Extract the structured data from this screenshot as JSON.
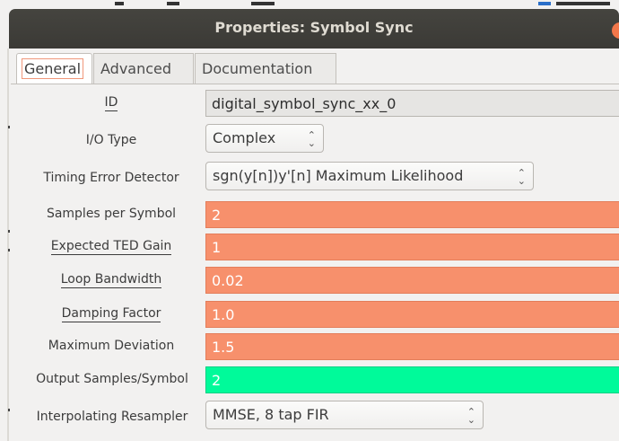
{
  "window": {
    "title": "Properties: Symbol Sync",
    "close_symbol": "×"
  },
  "tabs": [
    {
      "label": "General",
      "active": true
    },
    {
      "label": "Advanced",
      "active": false
    },
    {
      "label": "Documentation",
      "active": false
    }
  ],
  "params": {
    "id": {
      "label": "ID",
      "value": "digital_symbol_sync_xx_0"
    },
    "io_type": {
      "label": "I/O Type",
      "value": "Complex",
      "options": [
        "Complex"
      ]
    },
    "ted": {
      "label": "Timing Error Detector",
      "value": "sgn(y[n])y'[n] Maximum Likelihood"
    },
    "sps": {
      "label": "Samples per Symbol",
      "value": "2"
    },
    "ted_gain": {
      "label": "Expected TED Gain",
      "value": "1"
    },
    "loop_bw": {
      "label": "Loop Bandwidth",
      "value": "0.02"
    },
    "damping": {
      "label": "Damping Factor",
      "value": "1.0"
    },
    "max_dev": {
      "label": "Maximum Deviation",
      "value": "1.5"
    },
    "out_sps": {
      "label": "Output Samples/Symbol",
      "value": "2"
    },
    "resampler": {
      "label": "Interpolating Resampler",
      "value": "MMSE, 8 tap FIR"
    }
  },
  "colors": {
    "error_field": "#f7906c",
    "ok_field": "#00fa9a",
    "titlebar": "#3c3b37",
    "close_button": "#f2774a"
  },
  "icons": {
    "combo_arrow": "⌃⌄"
  }
}
